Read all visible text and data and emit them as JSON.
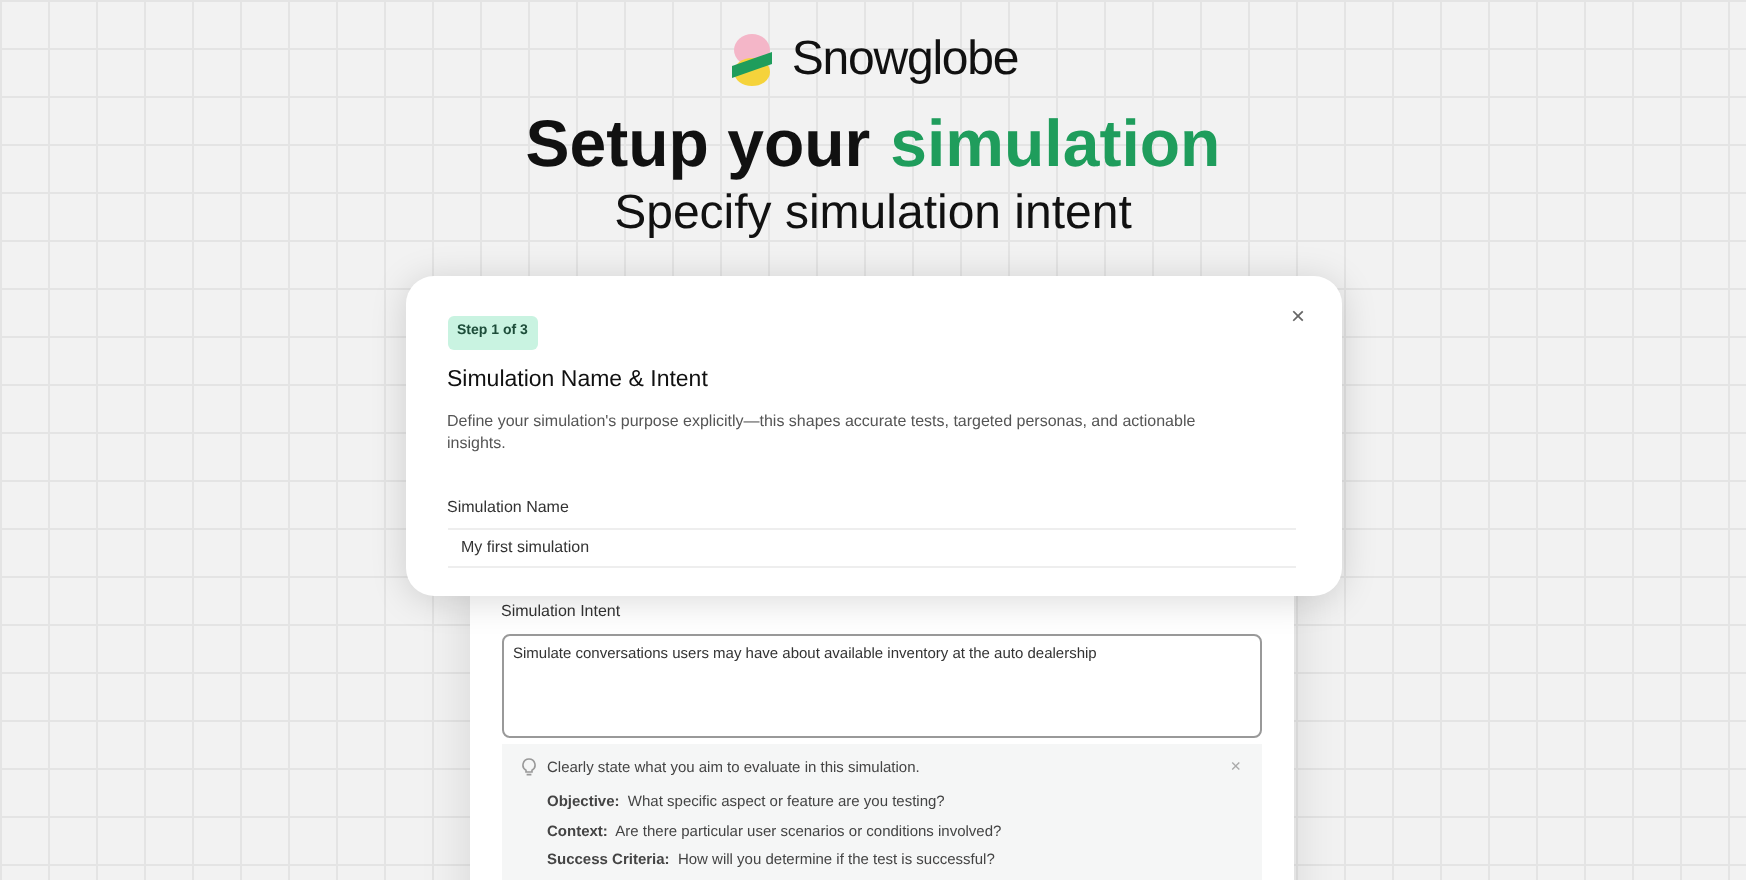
{
  "brand": {
    "name": "Snowglobe"
  },
  "headline": {
    "lead": "Setup your",
    "highlight": "simulation",
    "subtitle": "Specify simulation intent"
  },
  "dialog": {
    "step": "Step 1 of 3",
    "close": "×",
    "title": "Simulation Name & Intent",
    "description": "Define your simulation's purpose explicitly—this shapes accurate tests, targeted personas, and actionable insights.",
    "name_label": "Simulation Name",
    "name_value": "My first simulation"
  },
  "intent": {
    "label": "Simulation Intent",
    "value": "Simulate conversations users may have about available inventory at the auto dealership",
    "hint": {
      "text": "Clearly state what you aim to evaluate in this simulation.",
      "close": "×",
      "items": [
        {
          "text": "**Objective:**  What specific aspect or feature are you testing?"
        },
        {
          "text": "**Context:**  Are there particular user scenarios or conditions involved?"
        },
        {
          "text": "**Success Criteria:**  How will you determine if the test is successful?"
        }
      ]
    }
  }
}
